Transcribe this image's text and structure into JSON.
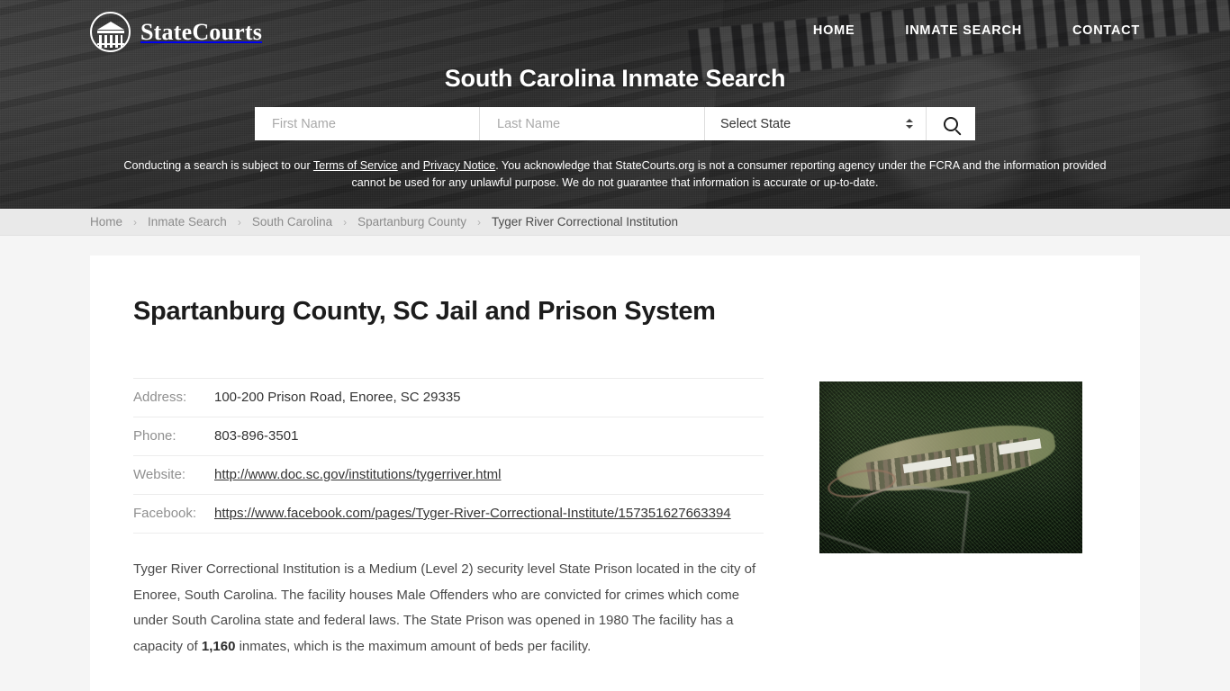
{
  "brand": {
    "name": "StateCourts",
    "logo_icon": "courthouse-circle-icon"
  },
  "nav": {
    "items": [
      {
        "label": "HOME"
      },
      {
        "label": "INMATE SEARCH"
      },
      {
        "label": "CONTACT"
      }
    ]
  },
  "hero": {
    "title": "South Carolina Inmate Search"
  },
  "search": {
    "first_name_placeholder": "First Name",
    "first_name_value": "",
    "last_name_placeholder": "Last Name",
    "last_name_value": "",
    "state_selected": "Select State",
    "submit_icon": "search-icon"
  },
  "disclaimer": {
    "part1": "Conducting a search is subject to our ",
    "terms_label": "Terms of Service",
    "part2": " and ",
    "privacy_label": "Privacy Notice",
    "part3": ". You acknowledge that StateCourts.org is not a consumer reporting agency under the FCRA and the information provided cannot be used for any unlawful purpose. We do not guarantee that information is accurate or up-to-date."
  },
  "breadcrumb": {
    "separator": "›",
    "items": [
      {
        "label": "Home",
        "current": false
      },
      {
        "label": "Inmate Search",
        "current": false
      },
      {
        "label": "South Carolina",
        "current": false
      },
      {
        "label": "Spartanburg County",
        "current": false
      },
      {
        "label": "Tyger River Correctional Institution",
        "current": true
      }
    ]
  },
  "main": {
    "heading": "Spartanburg County, SC Jail and Prison System",
    "facts": [
      {
        "label": "Address:",
        "value": "100-200 Prison Road, Enoree, SC 29335",
        "link": false
      },
      {
        "label": "Phone:",
        "value": "803-896-3501",
        "link": false
      },
      {
        "label": "Website:",
        "value": "http://www.doc.sc.gov/institutions/tygerriver.html",
        "link": true
      },
      {
        "label": "Facebook:",
        "value": "https://www.facebook.com/pages/Tyger-River-Correctional-Institute/157351627663394",
        "link": true
      }
    ],
    "description": {
      "before": "Tyger River Correctional Institution is a Medium (Level 2) security level State Prison located in the city of Enoree, South Carolina. The facility houses Male Offenders who are convicted for crimes which come under South Carolina state and federal laws. The State Prison was opened in 1980 The facility has a capacity of ",
      "capacity": "1,160",
      "after": " inmates, which is the maximum amount of beds per facility."
    },
    "photo_alt": "aerial-photo-tyger-river-correctional-institution"
  },
  "colors": {
    "header_overlay": "#2c2c2e",
    "breadcrumb_bar": "#e9e9e9",
    "page_background": "#f5f5f5",
    "card_background": "#ffffff",
    "heading_text": "#1c1c1c",
    "label_text": "#8f8f8f",
    "value_text": "#333333",
    "body_text": "#4a4a4a"
  }
}
